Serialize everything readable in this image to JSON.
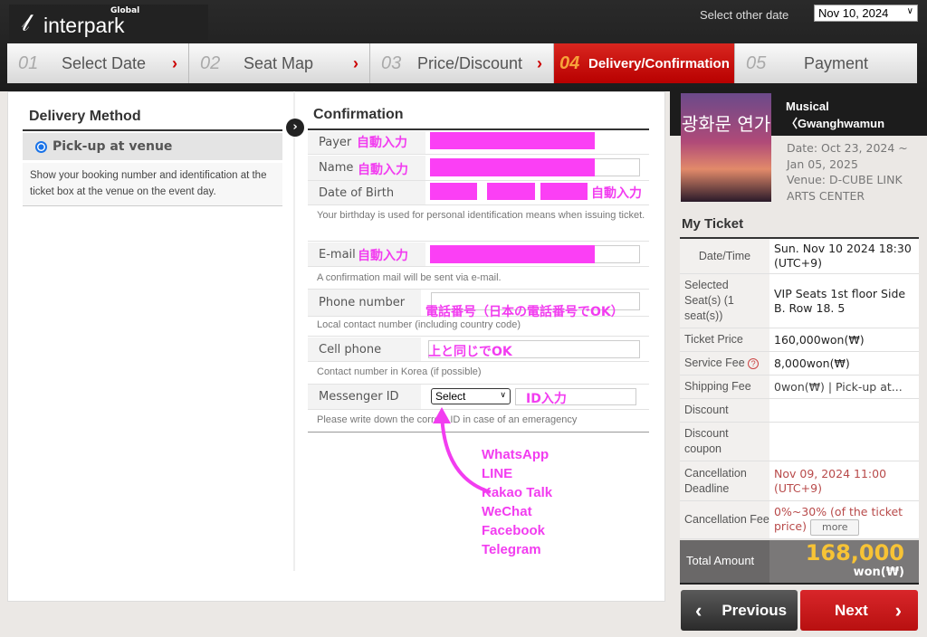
{
  "header": {
    "logo_text": "interpark",
    "logo_sub": "Global",
    "select_other_date_label": "Select other date",
    "selected_date": "Nov 10, 2024"
  },
  "steps": [
    {
      "num": "01",
      "label": "Select Date"
    },
    {
      "num": "02",
      "label": "Seat Map"
    },
    {
      "num": "03",
      "label": "Price/Discount"
    },
    {
      "num": "04",
      "label": "Delivery/Confirmation",
      "active": true
    },
    {
      "num": "05",
      "label": "Payment"
    }
  ],
  "delivery": {
    "title": "Delivery Method",
    "option": "Pick-up at venue",
    "description": "Show your booking number and identification at the ticket box at the venue on the event day."
  },
  "confirmation": {
    "title": "Confirmation",
    "payer_label": "Payer",
    "name_label": "Name",
    "dob_label": "Date of Birth",
    "dob_note": "Your birthday is used for personal identification means when issuing ticket.",
    "email_label": "E-mail",
    "email_note": "A confirmation mail will be sent via e-mail.",
    "phone_label": "Phone number",
    "phone_note": "Local contact number (including country code)",
    "cell_label": "Cell phone",
    "cell_note": "Contact number in Korea (if possible)",
    "messenger_label": "Messenger ID",
    "messenger_select": "Select",
    "messenger_note": "Please write down the correct ID in case of an emeragency"
  },
  "annotations": {
    "auto": "自動入力",
    "phone": "電話番号（日本の電話番号でOK）",
    "cell": "上と同じでOK",
    "id": "ID入力",
    "messengers": [
      "WhatsApp",
      "LINE",
      "Kakao Talk",
      "WeChat",
      "Facebook",
      "Telegram"
    ],
    "color": "#f23df0"
  },
  "show": {
    "category": "Musical",
    "title": "〈Gwanghwamun",
    "poster_text": "광화문 연가",
    "date": "Date: Oct 23, 2024 ~ Jan 05, 2025",
    "venue": "Venue: D-CUBE LINK ARTS CENTER"
  },
  "ticket": {
    "title": "My Ticket",
    "date_time_label": "Date/Time",
    "date_time": "Sun. Nov 10 2024 18:30 (UTC+9)",
    "seat_label": "Selected Seat(s) (1 seat(s))",
    "seat": "VIP Seats 1st floor Side B. Row 18. 5",
    "price_label": "Ticket Price",
    "price": "160,000won(₩)",
    "service_label": "Service Fee",
    "service": "8,000won(₩)",
    "shipping_label": "Shipping Fee",
    "shipping": "0won(₩) | Pick-up at...",
    "discount_label": "Discount",
    "coupon_label": "Discount coupon",
    "deadline_label": "Cancellation Deadline",
    "deadline": "Nov 09, 2024 11:00 (UTC+9)",
    "cancel_fee_label": "Cancellation Fee",
    "cancel_fee": "0%~30% (of the ticket price)",
    "more": "more",
    "total_label": "Total Amount",
    "total": "168,000",
    "currency": "won(₩)"
  },
  "buttons": {
    "previous": "Previous",
    "next": "Next"
  },
  "colors": {
    "accent": "#c00000",
    "total": "#f7c335"
  }
}
